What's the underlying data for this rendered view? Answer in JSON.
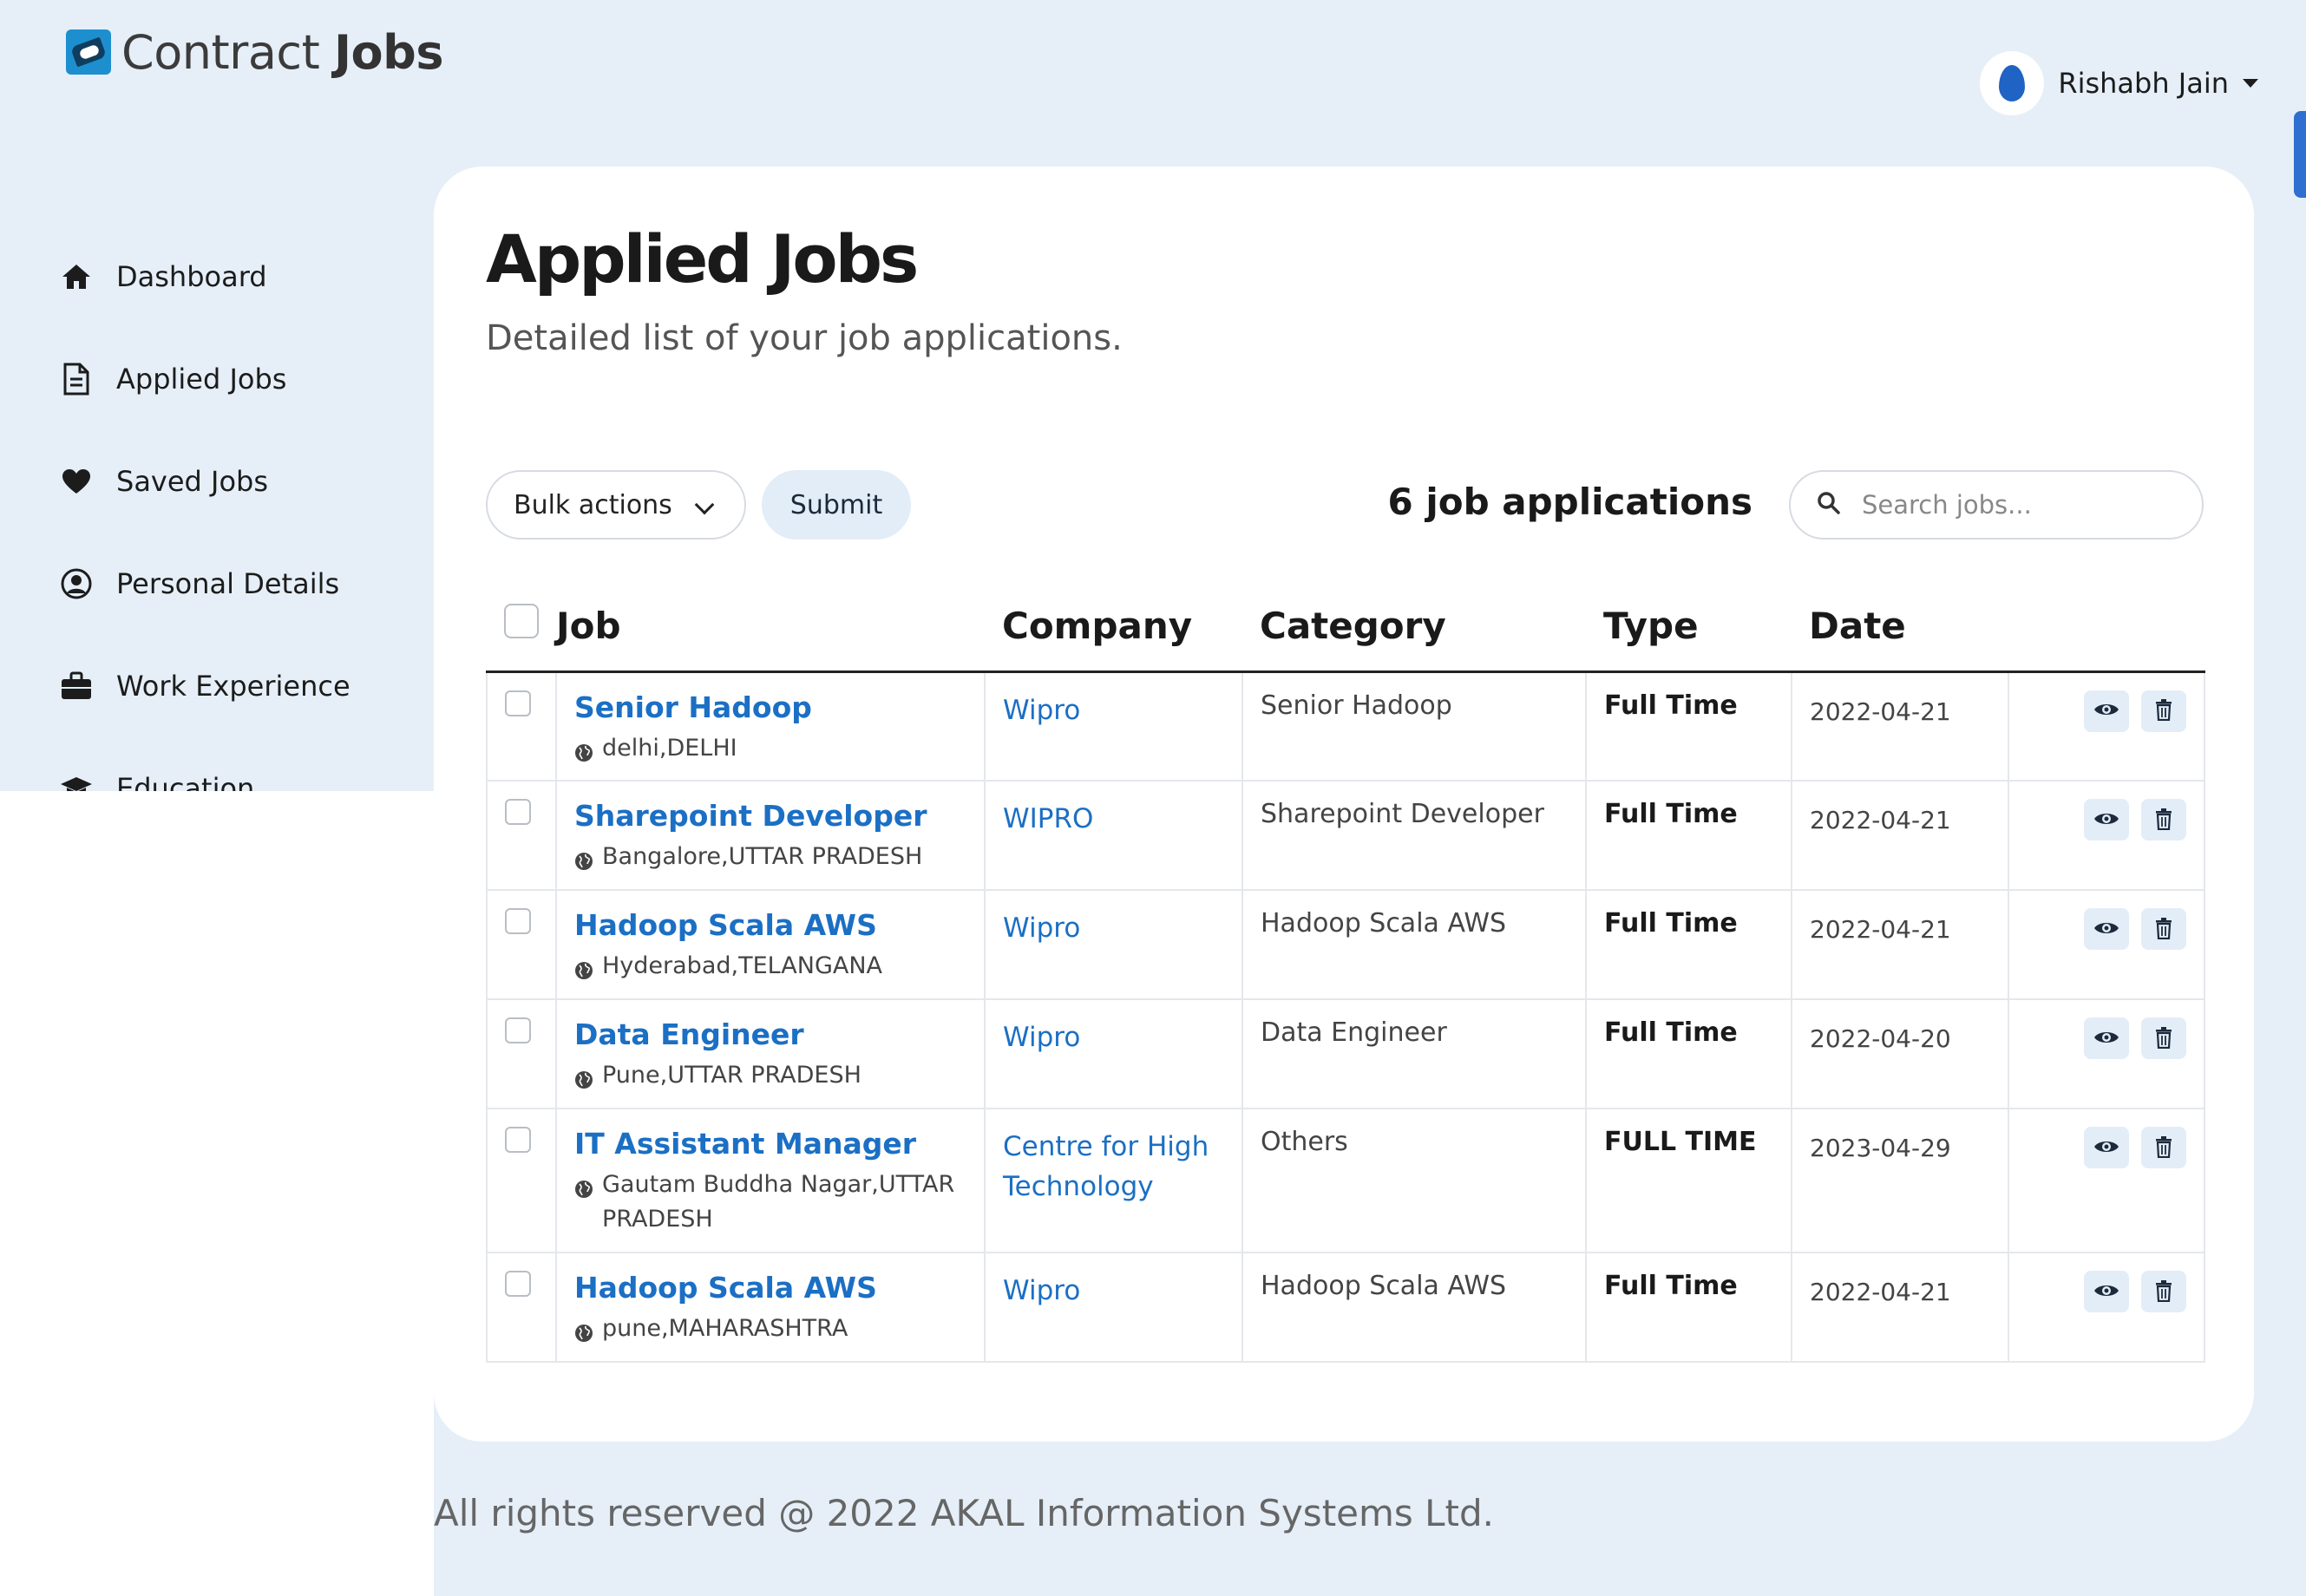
{
  "brand": {
    "name_light": "Contract",
    "name_bold": "Jobs"
  },
  "user": {
    "name": "Rishabh Jain"
  },
  "sidebar": {
    "items": [
      {
        "label": "Dashboard",
        "icon": "home-icon"
      },
      {
        "label": "Applied Jobs",
        "icon": "document-icon"
      },
      {
        "label": "Saved Jobs",
        "icon": "heart-icon"
      },
      {
        "label": "Personal Details",
        "icon": "user-circle-icon"
      },
      {
        "label": "Work Experience",
        "icon": "briefcase-icon"
      },
      {
        "label": "Education",
        "icon": "graduation-cap-icon"
      }
    ]
  },
  "page": {
    "title": "Applied Jobs",
    "subtitle": "Detailed list of your job applications."
  },
  "toolbar": {
    "bulk_label": "Bulk actions",
    "submit_label": "Submit",
    "count_label": "6 job applications",
    "search_placeholder": "Search jobs..."
  },
  "table": {
    "headers": {
      "job": "Job",
      "company": "Company",
      "category": "Category",
      "type": "Type",
      "date": "Date"
    },
    "rows": [
      {
        "title": "Senior Hadoop",
        "location": "delhi,DELHI",
        "company": "Wipro",
        "category": "Senior Hadoop",
        "type": "Full Time",
        "date": "2022-04-21"
      },
      {
        "title": "Sharepoint Developer",
        "location": "Bangalore,UTTAR PRADESH",
        "company": "WIPRO",
        "category": "Sharepoint Developer",
        "type": "Full Time",
        "date": "2022-04-21"
      },
      {
        "title": "Hadoop Scala AWS",
        "location": "Hyderabad,TELANGANA",
        "company": "Wipro",
        "category": "Hadoop Scala AWS",
        "type": "Full Time",
        "date": "2022-04-21"
      },
      {
        "title": "Data Engineer",
        "location": "Pune,UTTAR PRADESH",
        "company": "Wipro",
        "category": "Data Engineer",
        "type": "Full Time",
        "date": "2022-04-20"
      },
      {
        "title": "IT Assistant Manager",
        "location": "Gautam Buddha Nagar,UTTAR PRADESH",
        "company": "Centre for High Technology",
        "category": "Others",
        "type": "FULL TIME",
        "date": "2023-04-29"
      },
      {
        "title": "Hadoop Scala AWS",
        "location": "pune,MAHARASHTRA",
        "company": "Wipro",
        "category": "Hadoop Scala AWS",
        "type": "Full Time",
        "date": "2022-04-21"
      }
    ]
  },
  "footer": {
    "text": "All rights reserved @ 2022 AKAL Information Systems Ltd."
  },
  "colors": {
    "background": "#e6eff8",
    "link": "#1b6fc4",
    "soft_button": "#e3edf7",
    "accent": "#2f6fd0"
  }
}
